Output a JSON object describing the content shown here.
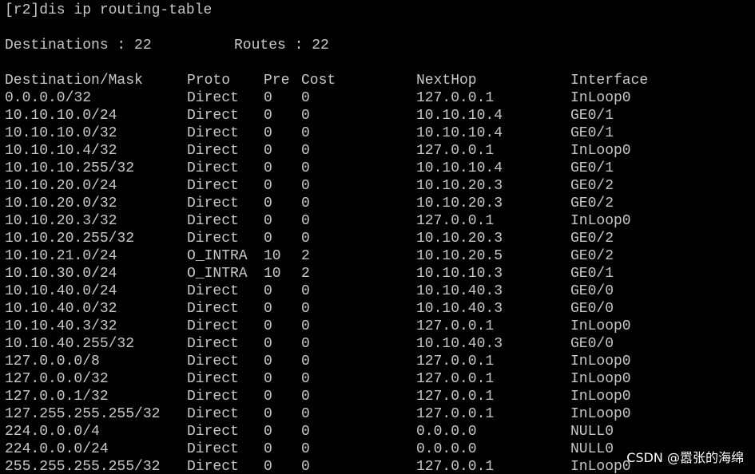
{
  "terminal": {
    "command": "[r2]dis ip routing-table",
    "summary": {
      "destinations_label": "Destinations : 22",
      "routes_label": "Routes : 22"
    },
    "columns": {
      "destination": "Destination/Mask",
      "proto": "Proto",
      "pre": "Pre",
      "cost": "Cost",
      "nexthop": "NextHop",
      "interface": "Interface"
    },
    "rows": [
      {
        "dest": "0.0.0.0/32",
        "proto": "Direct",
        "pre": "0",
        "cost": "0",
        "nexthop": "127.0.0.1",
        "iface": "InLoop0"
      },
      {
        "dest": "10.10.10.0/24",
        "proto": "Direct",
        "pre": "0",
        "cost": "0",
        "nexthop": "10.10.10.4",
        "iface": "GE0/1"
      },
      {
        "dest": "10.10.10.0/32",
        "proto": "Direct",
        "pre": "0",
        "cost": "0",
        "nexthop": "10.10.10.4",
        "iface": "GE0/1"
      },
      {
        "dest": "10.10.10.4/32",
        "proto": "Direct",
        "pre": "0",
        "cost": "0",
        "nexthop": "127.0.0.1",
        "iface": "InLoop0"
      },
      {
        "dest": "10.10.10.255/32",
        "proto": "Direct",
        "pre": "0",
        "cost": "0",
        "nexthop": "10.10.10.4",
        "iface": "GE0/1"
      },
      {
        "dest": "10.10.20.0/24",
        "proto": "Direct",
        "pre": "0",
        "cost": "0",
        "nexthop": "10.10.20.3",
        "iface": "GE0/2"
      },
      {
        "dest": "10.10.20.0/32",
        "proto": "Direct",
        "pre": "0",
        "cost": "0",
        "nexthop": "10.10.20.3",
        "iface": "GE0/2"
      },
      {
        "dest": "10.10.20.3/32",
        "proto": "Direct",
        "pre": "0",
        "cost": "0",
        "nexthop": "127.0.0.1",
        "iface": "InLoop0"
      },
      {
        "dest": "10.10.20.255/32",
        "proto": "Direct",
        "pre": "0",
        "cost": "0",
        "nexthop": "10.10.20.3",
        "iface": "GE0/2"
      },
      {
        "dest": "10.10.21.0/24",
        "proto": "O_INTRA",
        "pre": "10",
        "cost": "2",
        "nexthop": "10.10.20.5",
        "iface": "GE0/2"
      },
      {
        "dest": "10.10.30.0/24",
        "proto": "O_INTRA",
        "pre": "10",
        "cost": "2",
        "nexthop": "10.10.10.3",
        "iface": "GE0/1"
      },
      {
        "dest": "10.10.40.0/24",
        "proto": "Direct",
        "pre": "0",
        "cost": "0",
        "nexthop": "10.10.40.3",
        "iface": "GE0/0"
      },
      {
        "dest": "10.10.40.0/32",
        "proto": "Direct",
        "pre": "0",
        "cost": "0",
        "nexthop": "10.10.40.3",
        "iface": "GE0/0"
      },
      {
        "dest": "10.10.40.3/32",
        "proto": "Direct",
        "pre": "0",
        "cost": "0",
        "nexthop": "127.0.0.1",
        "iface": "InLoop0"
      },
      {
        "dest": "10.10.40.255/32",
        "proto": "Direct",
        "pre": "0",
        "cost": "0",
        "nexthop": "10.10.40.3",
        "iface": "GE0/0"
      },
      {
        "dest": "127.0.0.0/8",
        "proto": "Direct",
        "pre": "0",
        "cost": "0",
        "nexthop": "127.0.0.1",
        "iface": "InLoop0"
      },
      {
        "dest": "127.0.0.0/32",
        "proto": "Direct",
        "pre": "0",
        "cost": "0",
        "nexthop": "127.0.0.1",
        "iface": "InLoop0"
      },
      {
        "dest": "127.0.0.1/32",
        "proto": "Direct",
        "pre": "0",
        "cost": "0",
        "nexthop": "127.0.0.1",
        "iface": "InLoop0"
      },
      {
        "dest": "127.255.255.255/32",
        "proto": "Direct",
        "pre": "0",
        "cost": "0",
        "nexthop": "127.0.0.1",
        "iface": "InLoop0"
      },
      {
        "dest": "224.0.0.0/4",
        "proto": "Direct",
        "pre": "0",
        "cost": "0",
        "nexthop": "0.0.0.0",
        "iface": "NULL0"
      },
      {
        "dest": "224.0.0.0/24",
        "proto": "Direct",
        "pre": "0",
        "cost": "0",
        "nexthop": "0.0.0.0",
        "iface": "NULL0"
      },
      {
        "dest": "255.255.255.255/32",
        "proto": "Direct",
        "pre": "0",
        "cost": "0",
        "nexthop": "127.0.0.1",
        "iface": "InLoop0"
      }
    ]
  },
  "watermark": "CSDN @嚣张的海绵",
  "colors": {
    "background": "#000000",
    "text": "#c8c8c8"
  }
}
